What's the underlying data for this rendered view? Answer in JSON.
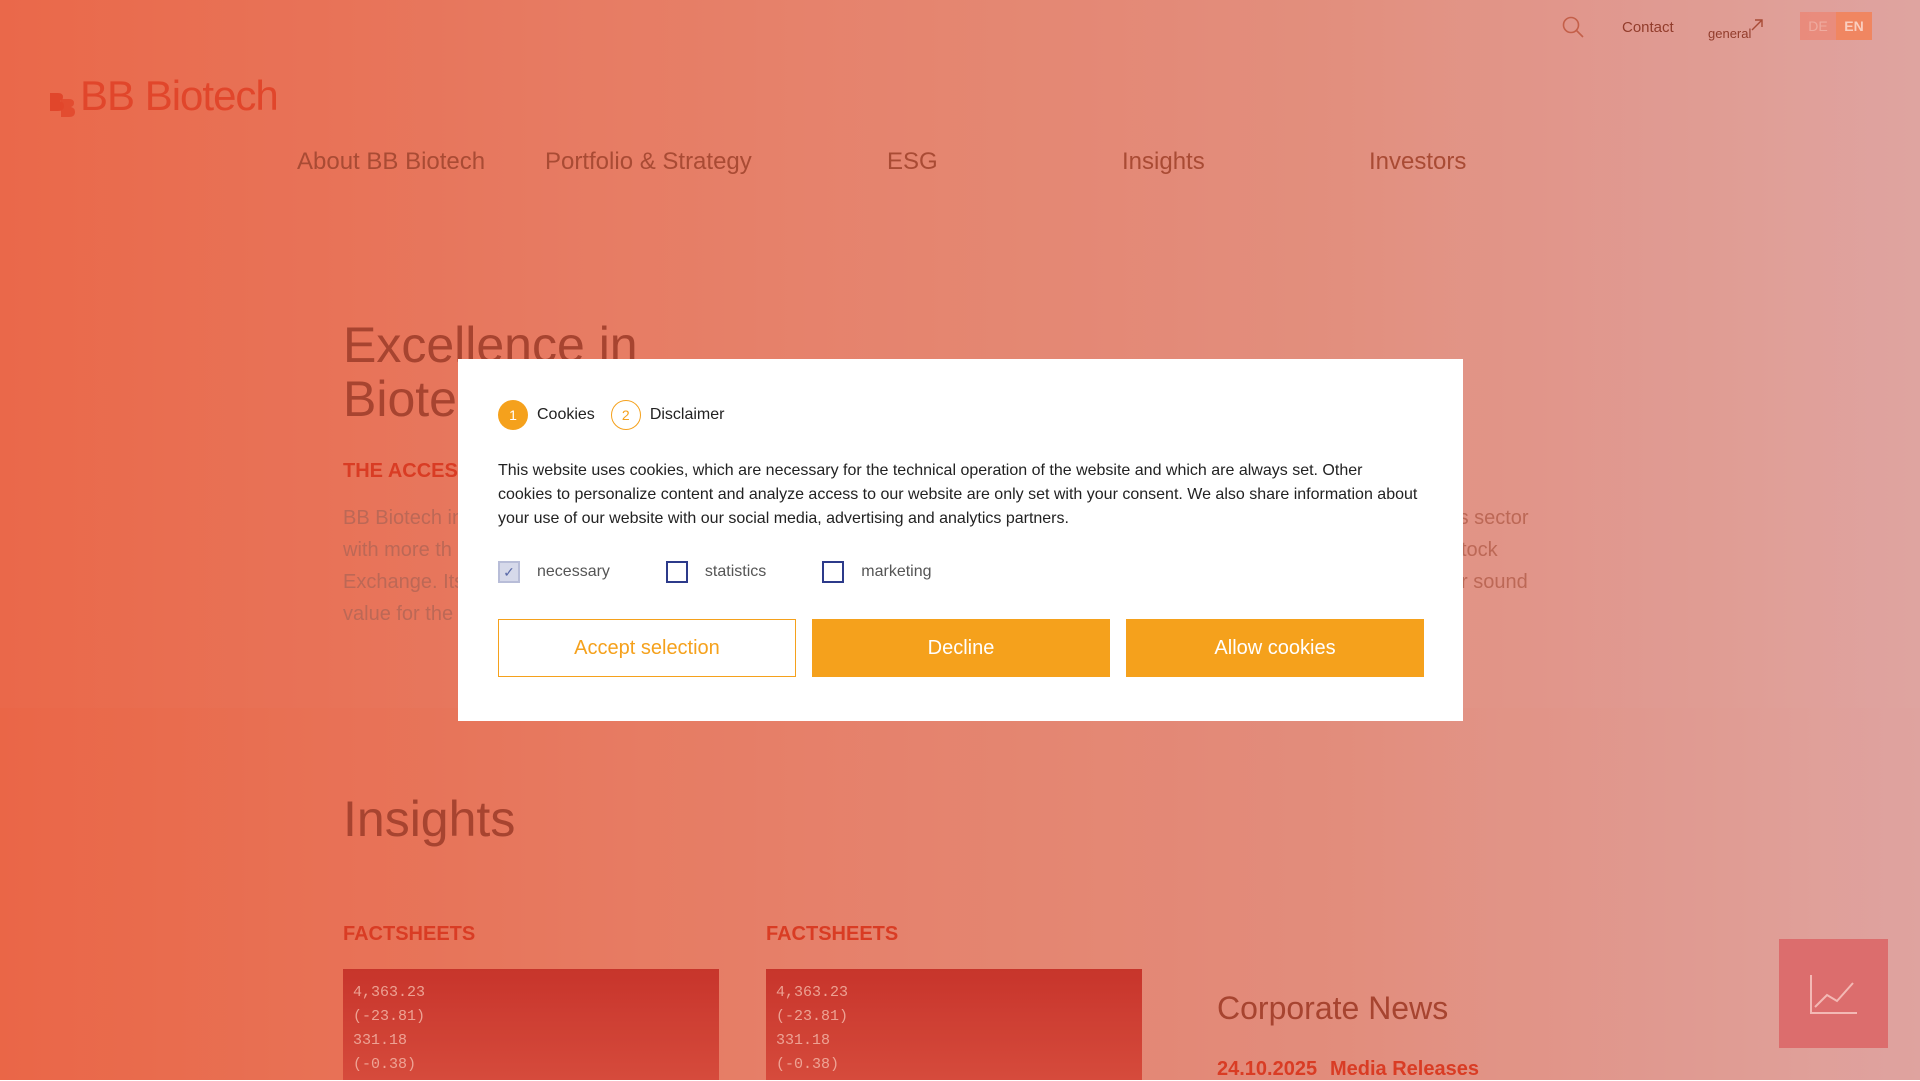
{
  "header": {
    "contact_label": "Contact",
    "lang_image_alt": "general",
    "languages": [
      "DE",
      "EN"
    ],
    "brand": "BB Biotech"
  },
  "nav": {
    "items": [
      "About BB Biotech",
      "Portfolio & Strategy",
      "ESG",
      "Insights",
      "Investors"
    ]
  },
  "hero": {
    "title_line1": "Excellence in",
    "title_line2": "Biote",
    "subtitle": "THE ACCES",
    "text_lines": [
      "BB Biotech in",
      "with more th",
      "Exchange. Its",
      "value for the"
    ],
    "text_right": [
      "his sector",
      "tock",
      "r sound"
    ]
  },
  "insights": {
    "title": "Insights",
    "cards": [
      {
        "label": "FACTSHEETS",
        "ticker": [
          "4,363.23",
          "(-23.81)",
          "331.18",
          "(-0.38)"
        ]
      },
      {
        "label": "FACTSHEETS",
        "ticker": [
          "4,363.23",
          "(-23.81)",
          "331.18",
          "(-0.38)"
        ]
      }
    ],
    "corporate_news": {
      "title": "Corporate News",
      "date": "24.10.2025",
      "category": "Media Releases"
    }
  },
  "modal": {
    "steps": [
      {
        "num": "1",
        "label": "Cookies"
      },
      {
        "num": "2",
        "label": "Disclaimer"
      }
    ],
    "text": "This website uses cookies, which are necessary for the technical operation of the website and which are always set. Other cookies to personalize content and analyze access to our website are only set with your consent. We also share information about your use of our website with our social media, advertising and analytics partners.",
    "options": [
      {
        "label": "necessary",
        "checked": true,
        "disabled": true
      },
      {
        "label": "statistics",
        "checked": false
      },
      {
        "label": "marketing",
        "checked": false
      }
    ],
    "buttons": {
      "accept_selection": "Accept selection",
      "decline": "Decline",
      "allow": "Allow cookies"
    }
  },
  "colors": {
    "accent": "#f5a11c",
    "brand": "#e0452a",
    "link_red": "#d73a22"
  }
}
